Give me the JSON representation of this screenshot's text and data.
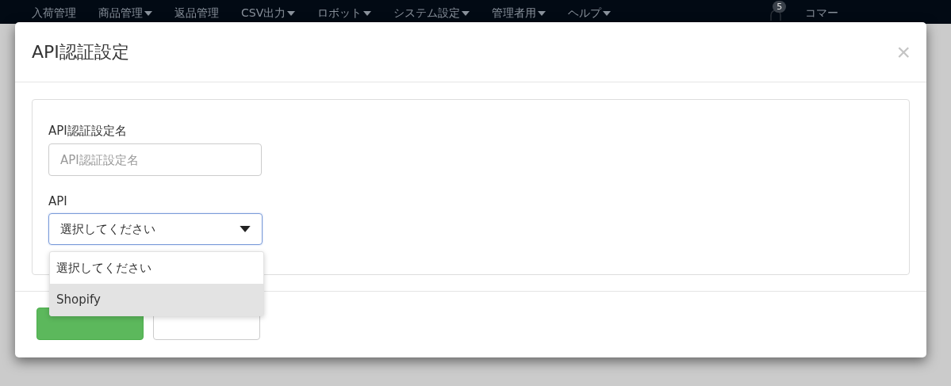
{
  "nav": {
    "items": [
      {
        "label": "入荷管理",
        "has_menu": false
      },
      {
        "label": "商品管理",
        "has_menu": true
      },
      {
        "label": "返品管理",
        "has_menu": false
      },
      {
        "label": "CSV出力",
        "has_menu": true
      },
      {
        "label": "ロボット",
        "has_menu": true
      },
      {
        "label": "システム設定",
        "has_menu": true
      },
      {
        "label": "管理者用",
        "has_menu": true
      },
      {
        "label": "ヘルプ",
        "has_menu": true
      }
    ],
    "notifications": {
      "count": "5"
    },
    "user": "コマー"
  },
  "modal": {
    "title": "API認証設定",
    "close": "×",
    "fields": [
      {
        "kind": "text",
        "label": "API認証設定名",
        "placeholder": "API認証設定名"
      },
      {
        "kind": "select",
        "label": "API",
        "value": "選択してください",
        "expanded": true,
        "options": [
          {
            "label": "選択してください",
            "highlighted": false
          },
          {
            "label": "Shopify",
            "highlighted": true
          }
        ]
      }
    ],
    "buttons": [
      {
        "kind": "primary"
      },
      {
        "kind": "secondary"
      }
    ]
  }
}
